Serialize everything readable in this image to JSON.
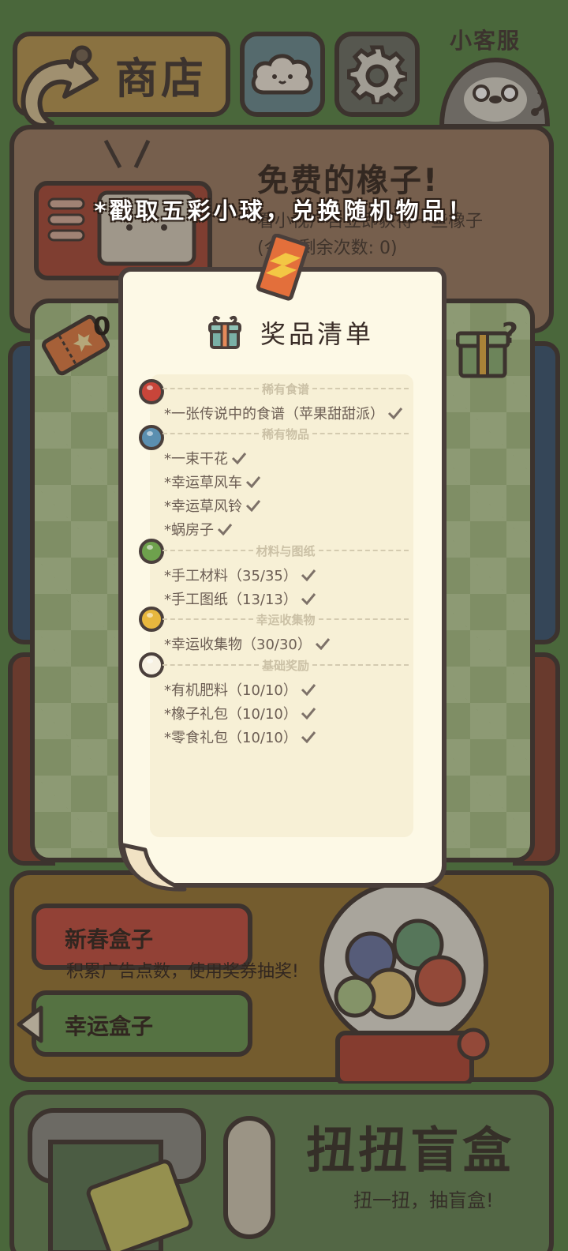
{
  "header": {
    "shop_title": "商店",
    "service_label": "小客服"
  },
  "acorn_panel": {
    "title": "免费的橡子!",
    "desc": "看小视广告立即获得一些橡子",
    "remaining": "(今日剩余次数: 0)"
  },
  "gacha": {
    "ticket_count": "0"
  },
  "banner": {
    "text": "*戳取五彩小球，兑换随机物品！"
  },
  "prize_list": {
    "title": "奖品清单",
    "sections": [
      {
        "name": "稀有食谱",
        "ball_color": "#c8453a",
        "items": [
          "*一张传说中的食谱（苹果甜甜派）"
        ]
      },
      {
        "name": "稀有物品",
        "ball_color": "#5b8fb0",
        "items": [
          "*一束干花",
          "*幸运草风车",
          "*幸运草风铃",
          "*蜗房子"
        ]
      },
      {
        "name": "材料与图纸",
        "ball_color": "#6ea14d",
        "items": [
          "*手工材料（35/35）",
          "*手工图纸（13/13）"
        ]
      },
      {
        "name": "幸运收集物",
        "ball_color": "#e8b73e",
        "items": [
          "*幸运收集物（30/30）"
        ]
      },
      {
        "name": "基础奖励",
        "ball_color": "#f7f1e2",
        "items": [
          "*有机肥料（10/10）",
          "*橡子礼包（10/10）",
          "*零食礼包（10/10）"
        ]
      }
    ]
  },
  "capsule": {
    "spring_box": "新春盒子",
    "lucky_box": "幸运盒子",
    "desc": "积累广告点数，使用奖券抽奖!"
  },
  "blindbox": {
    "title": "扭扭盲盒",
    "subtitle": "扭一扭，抽盲盒!"
  },
  "colors": {
    "background": "#5e8a4e",
    "card": "#fdf9e6",
    "outline": "#4a3f3b"
  }
}
